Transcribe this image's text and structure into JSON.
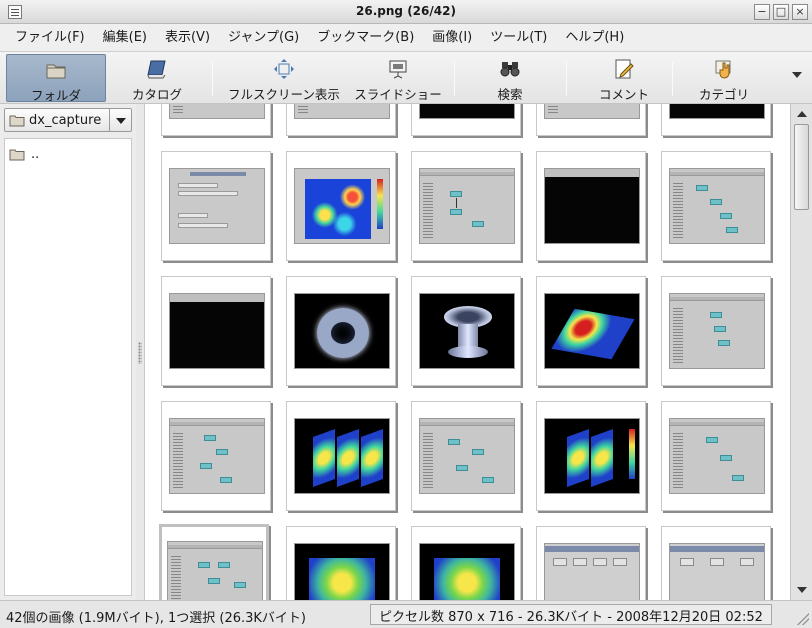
{
  "window": {
    "title": "26.png (26/42)"
  },
  "menubar": [
    {
      "label": "ファイル(F)"
    },
    {
      "label": "編集(E)"
    },
    {
      "label": "表示(V)"
    },
    {
      "label": "ジャンプ(G)"
    },
    {
      "label": "ブックマーク(B)"
    },
    {
      "label": "画像(I)"
    },
    {
      "label": "ツール(T)"
    },
    {
      "label": "ヘルプ(H)"
    }
  ],
  "toolbar": {
    "folder": {
      "label": "フォルダ",
      "icon": "folder-icon",
      "active": true
    },
    "catalog": {
      "label": "カタログ",
      "icon": "catalog-book-icon"
    },
    "fullscreen": {
      "label": "フルスクリーン表示",
      "icon": "fullscreen-arrows-icon"
    },
    "slideshow": {
      "label": "スライドショー",
      "icon": "slideshow-projector-icon"
    },
    "search": {
      "label": "検索",
      "icon": "binoculars-icon"
    },
    "comment": {
      "label": "コメント",
      "icon": "pencil-note-icon"
    },
    "category": {
      "label": "カテゴリ",
      "icon": "hand-card-icon"
    }
  },
  "sidebar": {
    "folder_combo": {
      "value": "dx_capture"
    },
    "items": [
      {
        "label": ".."
      }
    ]
  },
  "status": {
    "left": "42個の画像 (1.9Mバイト), 1つ選択 (26.3Kバイト)",
    "right": "ピクセル数 870 x 716 - 26.3Kバイト - 2008年12月20日 02:52"
  },
  "colors": {
    "accent_active_tool": "#98adc4",
    "thumb_background": "#ffffff",
    "node_cyan": "#6fc1c8"
  }
}
